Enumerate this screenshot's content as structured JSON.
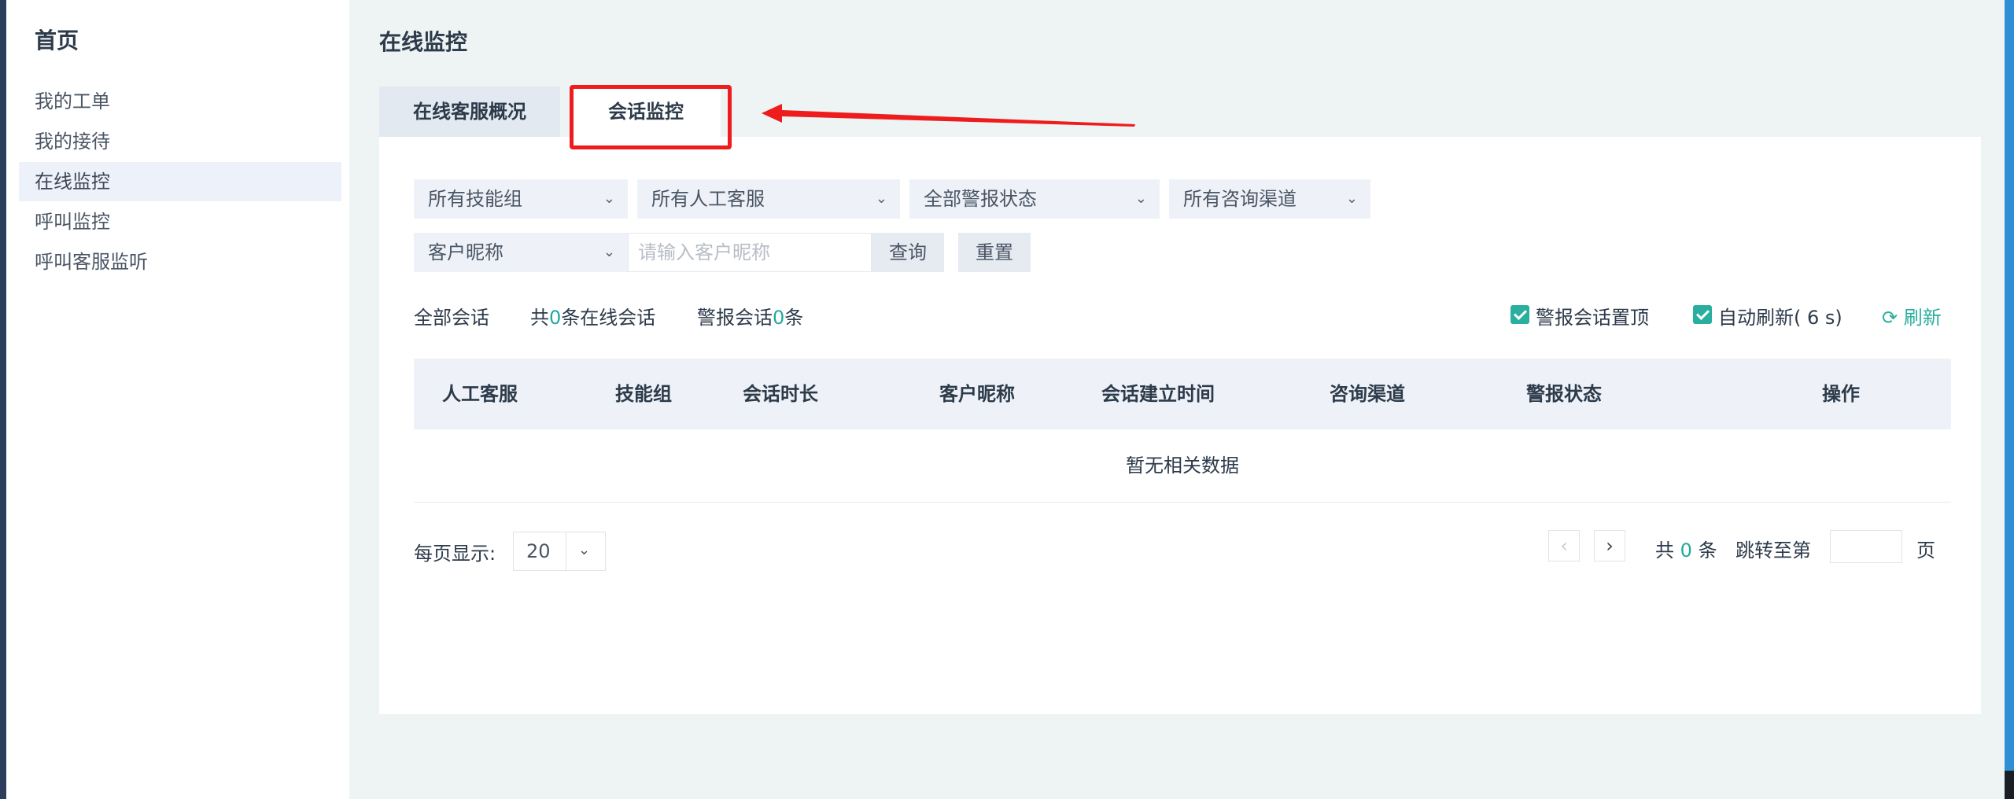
{
  "sidebar": {
    "title": "首页",
    "items": [
      {
        "label": "我的工单"
      },
      {
        "label": "我的接待"
      },
      {
        "label": "在线监控"
      },
      {
        "label": "呼叫监控"
      },
      {
        "label": "呼叫客服监听"
      }
    ],
    "active_item": "在线监控"
  },
  "main": {
    "title": "在线监控",
    "tabs": [
      {
        "label": "在线客服概况"
      },
      {
        "label": "会话监控"
      }
    ],
    "active_tab": "会话监控"
  },
  "filters": {
    "skill_group": "所有技能组",
    "agent": "所有人工客服",
    "alarm_status": "全部警报状态",
    "channel": "所有咨询渠道",
    "search_type": "客户昵称",
    "search_placeholder": "请输入客户昵称",
    "query_label": "查询",
    "reset_label": "重置"
  },
  "stats": {
    "all_sessions": "全部会话",
    "online_prefix": "共",
    "online_count": "0",
    "online_suffix": "条在线会话",
    "alarm_prefix": "警报会话",
    "alarm_count": "0",
    "alarm_suffix": "条"
  },
  "options": {
    "pin_alarm": "警报会话置顶",
    "pin_alarm_checked": true,
    "auto_refresh": "自动刷新( 6 s)",
    "auto_refresh_checked": true,
    "refresh_label": "刷新"
  },
  "table": {
    "columns": [
      "人工客服",
      "技能组",
      "会话时长",
      "客户昵称",
      "会话建立时间",
      "咨询渠道",
      "警报状态",
      "操作"
    ],
    "empty_text": "暂无相关数据"
  },
  "pagination": {
    "page_size_label": "每页显示:",
    "page_size": "20",
    "total_prefix": "共",
    "total_count": "0",
    "total_suffix": "条",
    "jump_label": "跳转至第",
    "page_unit": "页"
  },
  "colors": {
    "accent": "#2aaf9f",
    "highlight": "#ee1c1c",
    "sidebar_active": "#edf1fa"
  }
}
